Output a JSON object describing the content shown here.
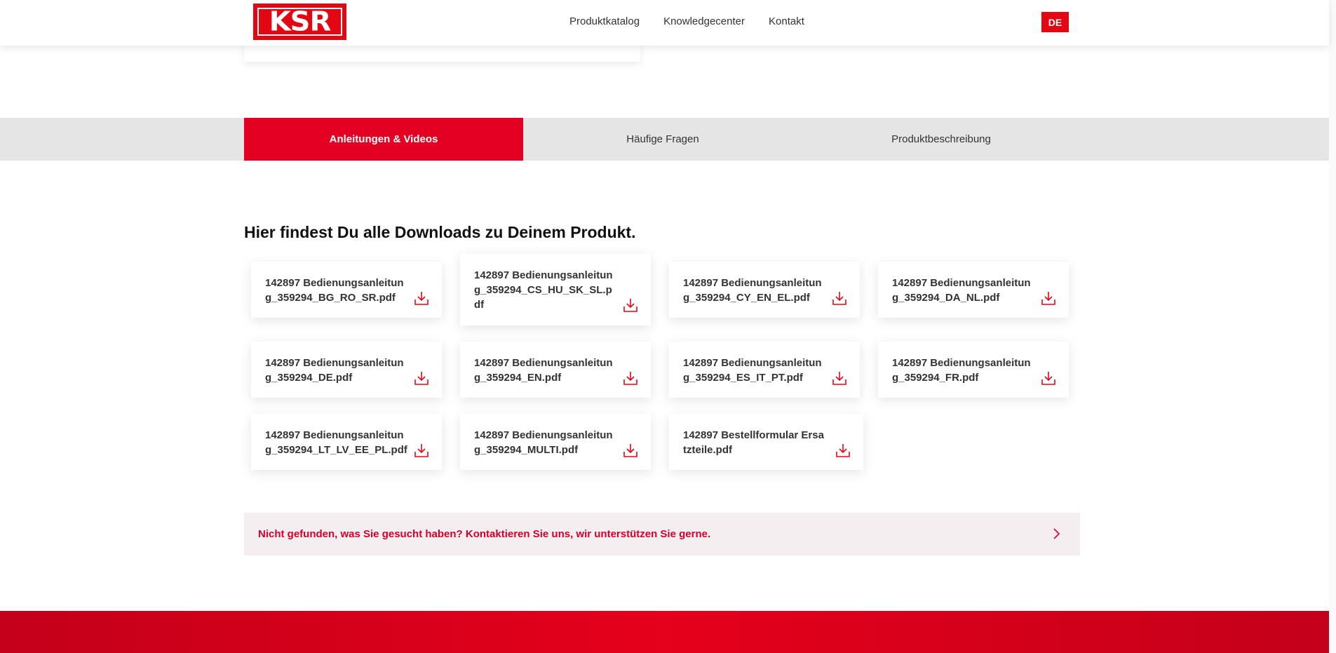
{
  "header": {
    "logo_text": "KSR",
    "nav": [
      "Produktkatalog",
      "Knowledgecenter",
      "Kontakt"
    ],
    "lang": "DE"
  },
  "tabs": [
    "Anleitungen & Videos",
    "Häufige Fragen",
    "Produktbeschreibung"
  ],
  "active_tab": 0,
  "main": {
    "heading": "Hier findest Du alle Downloads zu Deinem Produkt."
  },
  "downloads": [
    "142897 Bedienungsanleitung_359294_BG_RO_SR.pdf",
    "142897 Bedienungsanleitung_359294_CS_HU_SK_SL.pdf",
    "142897 Bedienungsanleitung_359294_CY_EN_EL.pdf",
    "142897 Bedienungsanleitung_359294_DA_NL.pdf",
    "142897 Bedienungsanleitung_359294_DE.pdf",
    "142897 Bedienungsanleitung_359294_EN.pdf",
    "142897 Bedienungsanleitung_359294_ES_IT_PT.pdf",
    "142897 Bedienungsanleitung_359294_FR.pdf",
    "142897 Bedienungsanleitung_359294_LT_LV_EE_PL.pdf",
    "142897 Bedienungsanleitung_359294_MULTI.pdf",
    "142897 Bestellformular Ersatzteile.pdf"
  ],
  "download_icon": "download-icon",
  "contact": {
    "text": "Nicht gefunden, was Sie gesucht haben? Kontaktieren Sie uns, wir unterstützen Sie gerne.",
    "icon": "chevron-right-icon"
  },
  "colors": {
    "brand_red": "#e30613",
    "tab_bar": "#e5e5e5",
    "contact_bg": "#f5eef0"
  }
}
